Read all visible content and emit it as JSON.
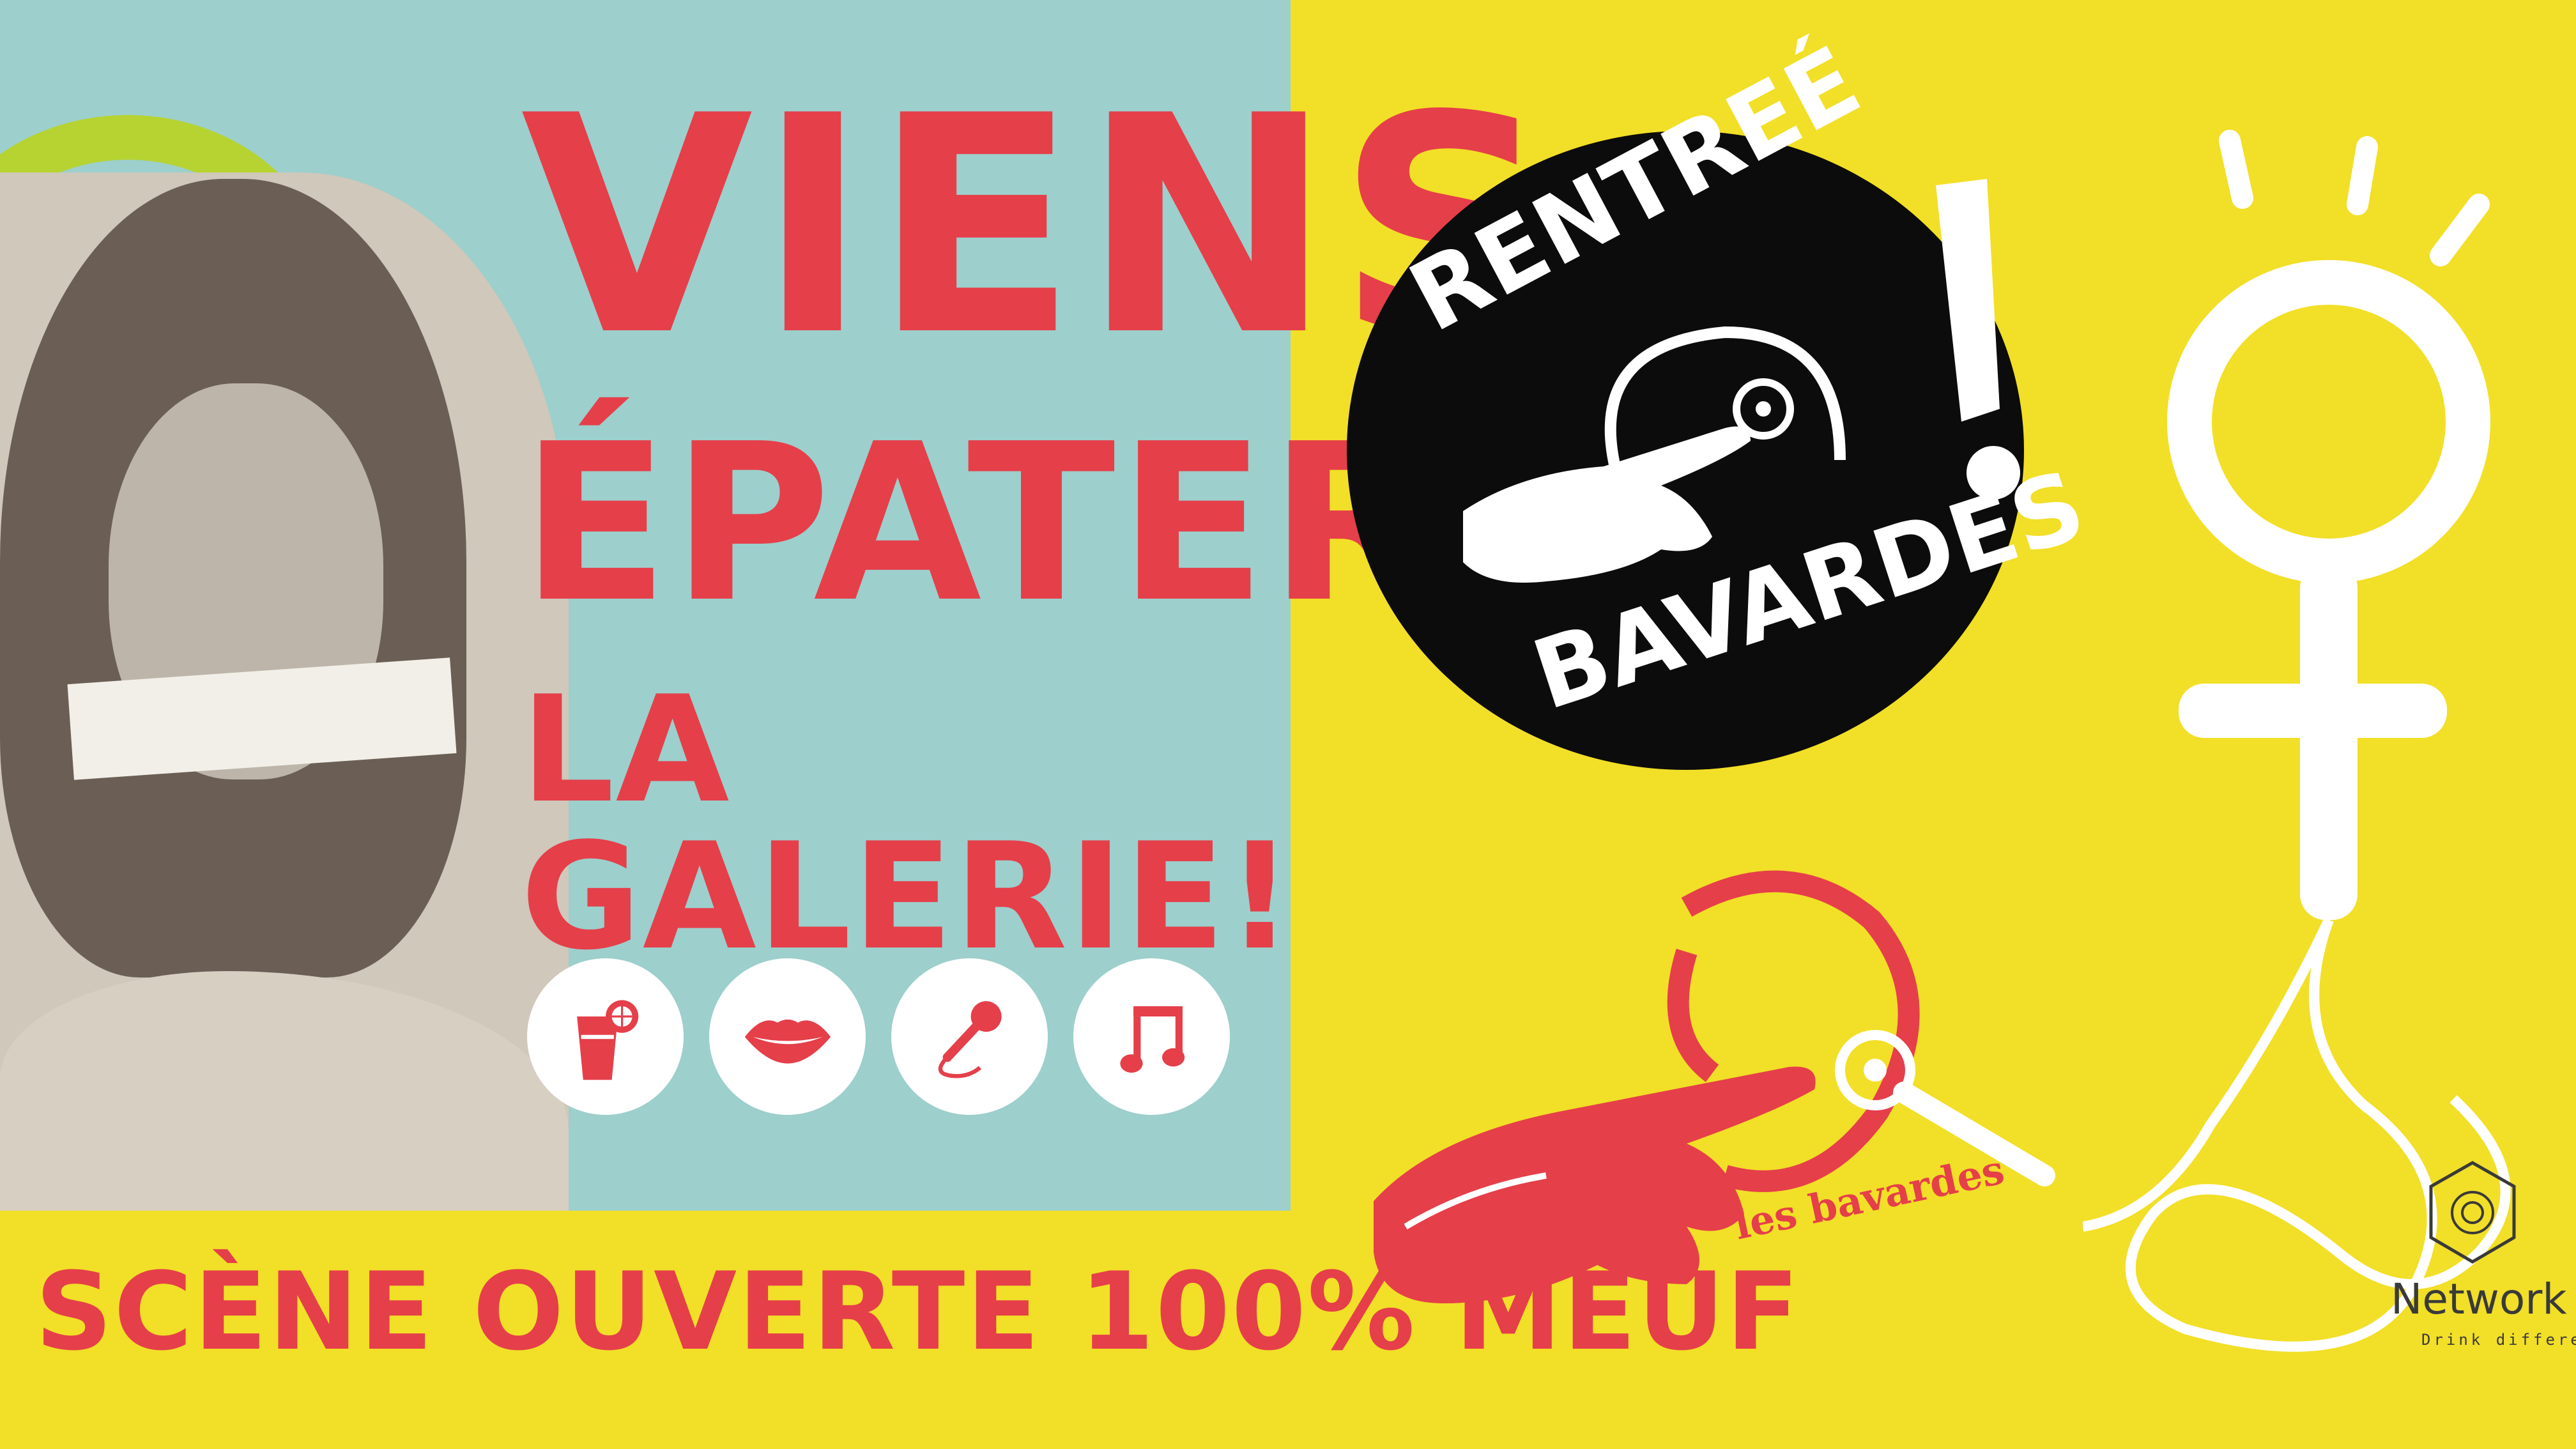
{
  "poster": {
    "headline": {
      "line1": "VIENS",
      "line2": "ÉPATER",
      "line3": "LA GALERIE!"
    },
    "tagline": "SCÈNE OUVERTE 100% MEUF",
    "icons": [
      "drink-icon",
      "lips-icon",
      "microphone-icon",
      "music-note-icon"
    ],
    "badge": {
      "top_text": "RENTREÉ",
      "bottom_text": "BAVARDES"
    },
    "logo_text": "les bavardes",
    "brand": {
      "name": "Network",
      "slogan": "Drink different"
    }
  },
  "colors": {
    "red": "#e53f4a",
    "yellow": "#f2df27",
    "teal": "#9dcfcc",
    "black": "#0c0c0c",
    "white": "#ffffff"
  }
}
